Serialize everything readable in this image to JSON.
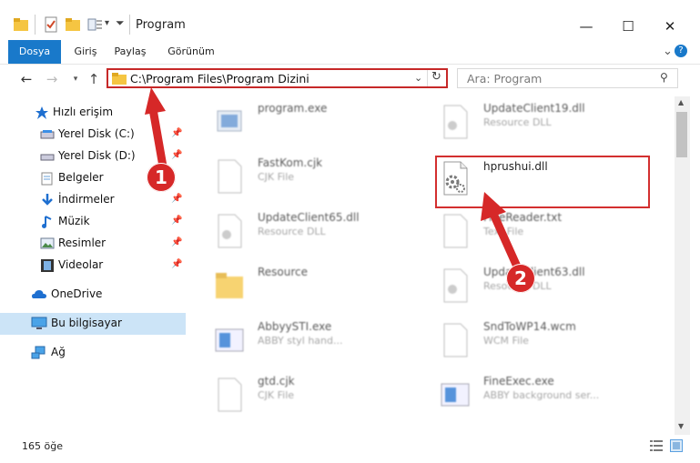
{
  "window": {
    "title": "Program",
    "minimize": "—",
    "maximize": "☐",
    "close": "✕"
  },
  "ribbon": {
    "tabs": [
      "Dosya",
      "Giriş",
      "Paylaş",
      "Görünüm"
    ],
    "collapse": "⌄",
    "help": "?"
  },
  "nav": {
    "address": "C:\\Program Files\\Program Dizini",
    "search_placeholder": "Ara: Program"
  },
  "sidebar": {
    "items": [
      {
        "label": "Hızlı erişim",
        "icon": "star-icon"
      },
      {
        "label": "Yerel Disk (C:)",
        "icon": "drive-icon"
      },
      {
        "label": "Yerel Disk (D:)",
        "icon": "drive-icon"
      },
      {
        "label": "Belgeler",
        "icon": "documents-icon"
      },
      {
        "label": "İndirmeler",
        "icon": "downloads-icon"
      },
      {
        "label": "Müzik",
        "icon": "music-icon"
      },
      {
        "label": "Resimler",
        "icon": "pictures-icon"
      },
      {
        "label": "Videolar",
        "icon": "videos-icon"
      },
      {
        "label": "OneDrive",
        "icon": "cloud-icon"
      },
      {
        "label": "Bu bilgisayar",
        "icon": "computer-icon"
      },
      {
        "label": "Ağ",
        "icon": "network-icon"
      }
    ]
  },
  "files": {
    "left": [
      {
        "name": "program.exe",
        "type": ""
      },
      {
        "name": "FastKom.cjk",
        "type": "CJK File"
      },
      {
        "name": "UpdateClient65.dll",
        "type": "Resource DLL"
      },
      {
        "name": "Resource",
        "type": ""
      },
      {
        "name": "AbbyySTI.exe",
        "type": "ABBY styl hand..."
      },
      {
        "name": "gtd.cjk",
        "type": "CJK File"
      }
    ],
    "right": [
      {
        "name": "UpdateClient19.dll",
        "type": "Resource DLL"
      },
      {
        "name": "hprushui.dll",
        "type": ""
      },
      {
        "name": "FineReader.txt",
        "type": "Text File"
      },
      {
        "name": "UpdateClient63.dll",
        "type": "Resource DLL"
      },
      {
        "name": "SndToWP14.wcm",
        "type": "WCM File"
      },
      {
        "name": "FineExec.exe",
        "type": "ABBY background ser..."
      }
    ]
  },
  "callouts": {
    "one": "1",
    "two": "2"
  },
  "status": {
    "count": "165 öğe"
  },
  "colors": {
    "accent": "#1979ca",
    "callout": "#d62828",
    "selection": "#cce4f7"
  }
}
